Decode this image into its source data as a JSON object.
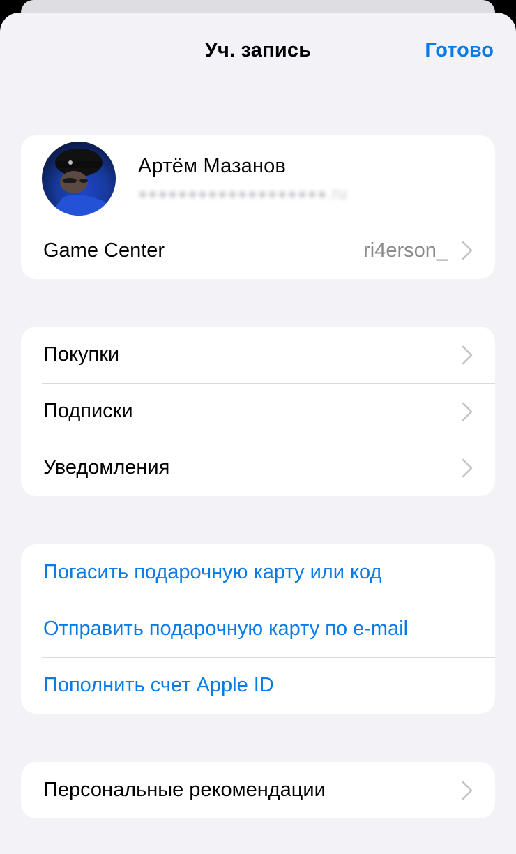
{
  "header": {
    "title": "Уч. запись",
    "done_label": "Готово"
  },
  "account": {
    "name": "Артём Мазанов",
    "email": "●●●●●●●●●●●●●●●●●●●.ru",
    "avatar_icon": "profile-photo"
  },
  "game_center": {
    "label": "Game Center",
    "value": "ri4erson_"
  },
  "menu": {
    "items": [
      {
        "label": "Покупки"
      },
      {
        "label": "Подписки"
      },
      {
        "label": "Уведомления"
      }
    ]
  },
  "gift": {
    "items": [
      {
        "label": "Погасить подарочную карту или код"
      },
      {
        "label": "Отправить подарочную карту по e-mail"
      },
      {
        "label": "Пополнить счет Apple ID"
      }
    ]
  },
  "personal": {
    "label": "Персональные рекомендации"
  },
  "colors": {
    "accent": "#0a7be6",
    "background": "#f2f2f7",
    "card": "#ffffff",
    "secondary_text": "#8a8a8e"
  }
}
